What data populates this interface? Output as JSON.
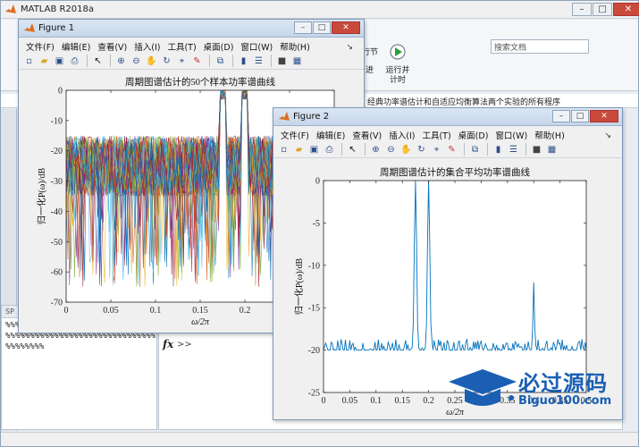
{
  "app": {
    "title": "MATLAB R2018a",
    "search_placeholder": "搜索文档"
  },
  "ribbon": {
    "run_section_label": "行节",
    "advance_label": "进",
    "run_time_label": "运行并\n计时"
  },
  "path_bar": {
    "text": "经典功率谱估计和自适应均衡算法两个实验的所有程序"
  },
  "command_history": {
    "header": "SP",
    "lines": [
      "%%%%%%%%%%%%%%%%%%%%%%%%%%%%%%",
      "%%%%%%%%%%%%%%%%%%%%%%%%%%%%%%%",
      "%%%%%%%%"
    ]
  },
  "command_window": {
    "prompt_icon": "fx",
    "prompt": ">>"
  },
  "figure_menu": [
    "文件(F)",
    "编辑(E)",
    "查看(V)",
    "插入(I)",
    "工具(T)",
    "桌面(D)",
    "窗口(W)",
    "帮助(H)"
  ],
  "toolbar_icons": [
    "new-file-icon",
    "open-icon",
    "save-icon",
    "print-icon",
    "pointer-icon",
    "zoom-in-icon",
    "zoom-out-icon",
    "pan-icon",
    "rotate-icon",
    "data-cursor-icon",
    "brush-icon",
    "link-icon",
    "colorbar-icon",
    "legend-icon",
    "hide-plot-tools-icon",
    "show-plot-tools-icon"
  ],
  "figure1": {
    "title": "Figure 1",
    "chart_data": {
      "type": "line",
      "title": "周期图谱估计的50个样本功率谱曲线",
      "xlabel": "ω/2π",
      "ylabel": "归一化P(ω)/dB",
      "xlim": [
        0,
        0.3
      ],
      "ylim": [
        -70,
        0
      ],
      "x_ticks": [
        "0",
        "0.05",
        "0.1",
        "0.15",
        "0.2",
        "0.25",
        "0.3"
      ],
      "y_ticks": [
        "0",
        "-10",
        "-20",
        "-30",
        "-40",
        "-50",
        "-60",
        "-70"
      ],
      "series_count": 50,
      "peaks": [
        {
          "x": 0.175,
          "y": 0
        },
        {
          "x": 0.2,
          "y": 0
        }
      ],
      "noise_floor": [
        -35,
        -15
      ],
      "colors": [
        "#0072bd",
        "#d95319",
        "#edb120",
        "#7e2f8e",
        "#77ac30",
        "#4dbeee",
        "#a2142f"
      ]
    }
  },
  "figure2": {
    "title": "Figure 2",
    "chart_data": {
      "type": "line",
      "title": "周期图谱估计的集合平均功率谱曲线",
      "xlabel": "ω/2π",
      "ylabel": "归一化P(ω)/dB",
      "xlim": [
        0,
        0.5
      ],
      "ylim": [
        -25,
        0
      ],
      "x_ticks": [
        "0",
        "0.05",
        "0.1",
        "0.15",
        "0.2",
        "0.25",
        "0.3",
        "0.35",
        "0.4",
        "0.45",
        "0.5"
      ],
      "y_ticks": [
        "0",
        "-5",
        "-10",
        "-15",
        "-20",
        "-25"
      ],
      "peaks": [
        {
          "x": 0.175,
          "y": 0
        },
        {
          "x": 0.2,
          "y": 0
        },
        {
          "x": 0.4,
          "y": -12
        }
      ],
      "noise_floor": -20,
      "color": "#0072bd"
    }
  },
  "watermark": {
    "text": "必过源码",
    "url": "Biguo100.com"
  }
}
